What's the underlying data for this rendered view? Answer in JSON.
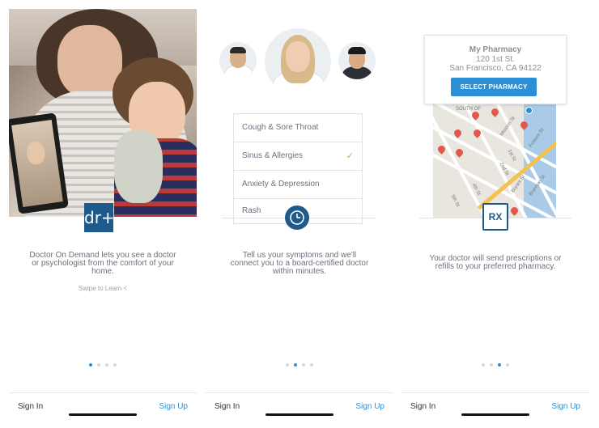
{
  "panels": [
    {
      "description": "Doctor On Demand lets you see a doctor or psychologist from the comfort of your home.",
      "swipe_hint": "Swipe to Learn <",
      "logo_text": "dr+",
      "dots": {
        "count": 4,
        "active": 0
      }
    },
    {
      "symptoms": [
        {
          "label": "Cough & Sore Throat",
          "checked": false
        },
        {
          "label": "Sinus & Allergies",
          "checked": true
        },
        {
          "label": "Anxiety & Depression",
          "checked": false
        },
        {
          "label": "Rash",
          "checked": false
        }
      ],
      "check_glyph": "✓",
      "description": "Tell us your symptoms and we'll connect you to a board-certified doctor within minutes.",
      "dots": {
        "count": 4,
        "active": 1
      }
    },
    {
      "pharmacy": {
        "name": "My Pharmacy",
        "address_line1": "120 1st St.",
        "address_line2": "San Francisco, CA 94122",
        "button_label": "SELECT PHARMACY"
      },
      "map_labels": [
        "Mission St",
        "1st St",
        "Folsom St",
        "2nd St",
        "4th St",
        "Bryant St",
        "Brannan St",
        "5th St",
        "SOUTH OF"
      ],
      "rx_text": "RX",
      "description": "Your doctor will send prescriptions or refills to your preferred pharmacy.",
      "dots": {
        "count": 4,
        "active": 2
      }
    }
  ],
  "footer": {
    "sign_in": "Sign In",
    "sign_up": "Sign Up"
  },
  "colors": {
    "accent": "#2b8fd6",
    "brand_navy": "#1f5a8c",
    "check": "#e3a13c",
    "pin": "#e4574d"
  },
  "icons": [
    "dr-logo-icon",
    "clock-icon",
    "check-icon",
    "map-pin-icon",
    "rx-icon"
  ]
}
